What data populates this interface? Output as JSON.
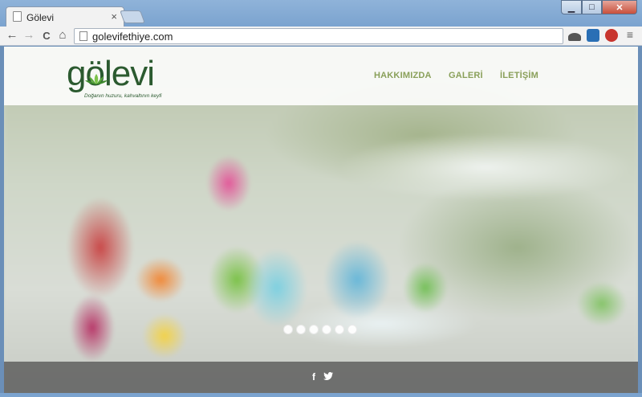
{
  "browser": {
    "tab_title": "Gölevi",
    "tab_close": "×",
    "url": "golevifethiye.com",
    "window_buttons": {
      "minimize": "▁",
      "maximize": "□",
      "close": "✕"
    },
    "nav": {
      "back": "←",
      "forward": "→",
      "reload": "C",
      "home": "⌂"
    }
  },
  "site": {
    "logo_text": "gölevi",
    "tagline": "Doğanın huzuru, kahvaltının keyfi",
    "menu": [
      {
        "label": "HAKKIMIZDA"
      },
      {
        "label": "GALERİ"
      },
      {
        "label": "İLETİŞİM"
      }
    ],
    "slider_dots": 6,
    "social": {
      "facebook": "f",
      "twitter": "🐦"
    }
  },
  "colors": {
    "menu": "#8aa05a",
    "logo": "#2b5a2f",
    "footer": "#5a5a5a"
  }
}
